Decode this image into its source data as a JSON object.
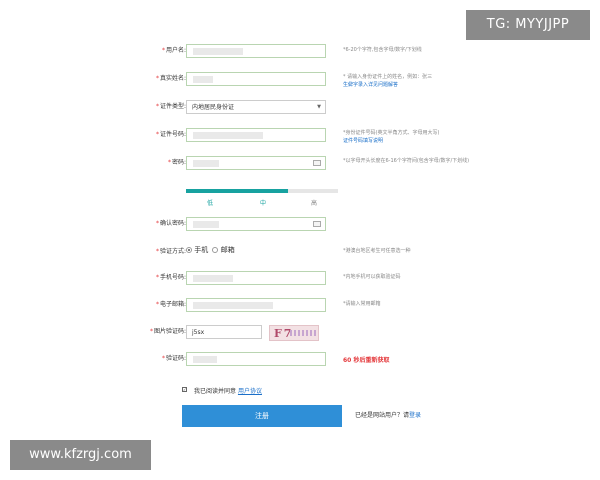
{
  "watermark_top": "TG: MYYJJPP",
  "watermark_bottom": "www.kfzrgj.com",
  "form": {
    "username": {
      "label": "用户名:",
      "hint": "*6-20个字符,包含字母/数字/下划线"
    },
    "realname": {
      "label": "真实姓名:",
      "hint": "* 请输入身份证件上的姓名，例如：张三",
      "hint_link": "生僻字录入详见问题解答"
    },
    "idtype": {
      "label": "证件类型:",
      "value": "内地居民身份证"
    },
    "idnumber": {
      "label": "证件号码:",
      "hint": "*身份证件号码(英文半角方式、字母用大写)",
      "hint_link": "证件号码填写说明"
    },
    "password": {
      "label": "密码:",
      "hint": "*以字母开头长度在6-16个字符间(包含字母/数字/下划线)"
    },
    "strength": {
      "weak": "低",
      "medium": "中",
      "strong": "高",
      "level_fraction": 0.67
    },
    "confirm": {
      "label": "确认密码:"
    },
    "verify_method": {
      "label": "验证方式:",
      "option_phone": "手机",
      "option_email": "邮箱",
      "hint": "*港澳台地区考生可任意选一种"
    },
    "phone": {
      "label": "手机号码:",
      "hint": "*内地手机可以获取验证码"
    },
    "email": {
      "label": "电子邮箱:",
      "hint": "*请输入常用邮箱"
    },
    "captcha": {
      "label": "图片验证码:",
      "value": "j5sx",
      "image_text": "F7"
    },
    "code": {
      "label": "验证码:",
      "countdown": "60 秒后重新获取"
    },
    "agree": {
      "text": "我已阅读并同意",
      "link": "用户协议"
    },
    "submit": "注册",
    "login_prompt": "已经是网站用户？请",
    "login_link": "登录"
  },
  "colors": {
    "accent": "#2f8fd7",
    "strength_bar": "#17a2a0",
    "link": "#1a6fc9",
    "warning": "#e4393c"
  }
}
